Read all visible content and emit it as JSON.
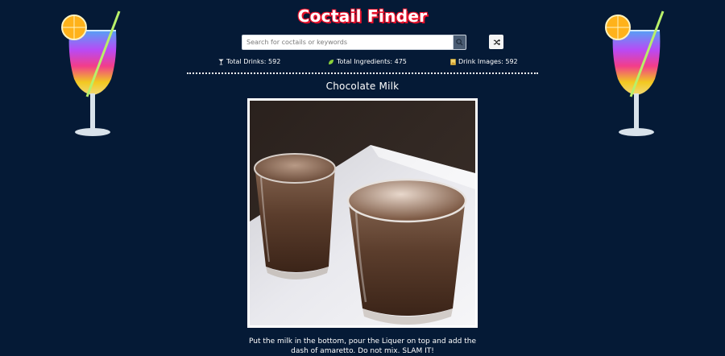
{
  "header": {
    "title": "Coctail Finder"
  },
  "search": {
    "placeholder": "Search for coctails or keywords",
    "value": ""
  },
  "stats": [
    {
      "icon": "cocktail-glass-icon",
      "label": "Total Drinks: 592"
    },
    {
      "icon": "lime-icon",
      "label": "Total Ingredients: 475"
    },
    {
      "icon": "image-icon",
      "label": "Drink Images: 592"
    }
  ],
  "drink": {
    "name": "Chocolate Milk",
    "instructions": "Put the milk in the bottom, pour the Liquer on top and add the dash of amaretto. Do not mix. SLAM IT!"
  },
  "colors": {
    "background": "#051a36",
    "title_outline": "#e8102a",
    "search_button": "#4a5c73"
  }
}
